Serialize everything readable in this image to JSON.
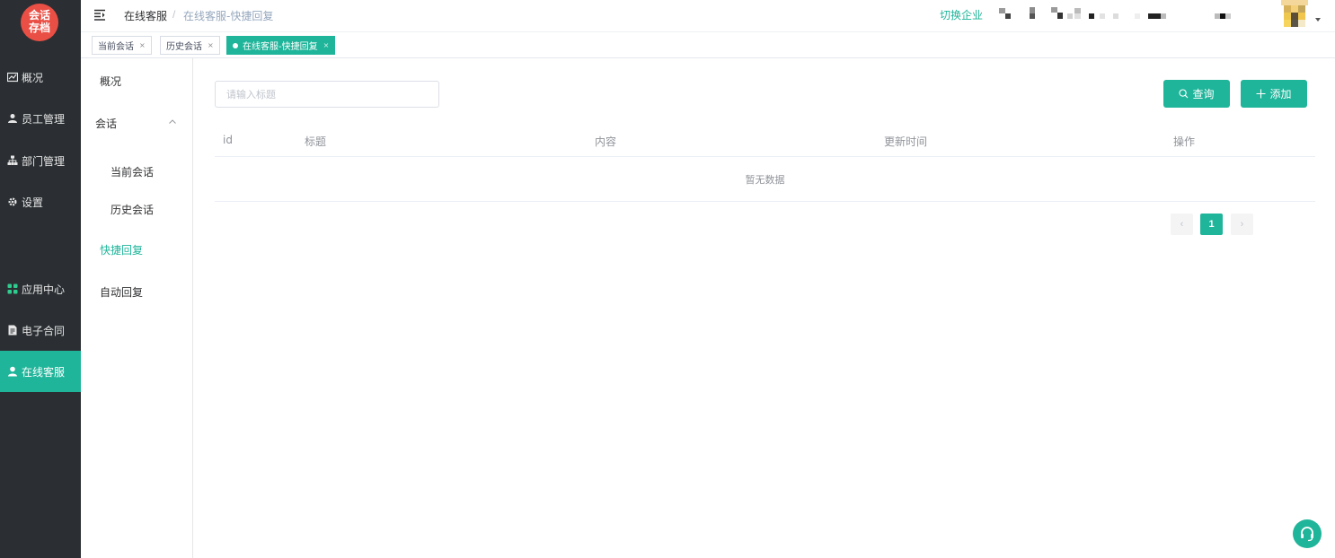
{
  "logo": {
    "line1": "会话",
    "line2": "存档",
    "color": "#ea4f45"
  },
  "sidenav": {
    "items": [
      {
        "label": "概况",
        "icon": "chart-icon"
      },
      {
        "label": "员工管理",
        "icon": "users-icon"
      },
      {
        "label": "部门管理",
        "icon": "org-icon"
      },
      {
        "label": "设置",
        "icon": "gear-icon"
      },
      {
        "label": "应用中心",
        "icon": "apps-icon"
      },
      {
        "label": "电子合同",
        "icon": "contract-icon"
      },
      {
        "label": "在线客服",
        "icon": "support-person-icon",
        "active": true
      }
    ],
    "active_color": "#1fb59a"
  },
  "header": {
    "breadcrumb": [
      "在线客服",
      "在线客服-快捷回复"
    ],
    "separator": "/",
    "switch_label": "切换企业"
  },
  "tags": [
    {
      "label": "当前会话",
      "close": "×"
    },
    {
      "label": "历史会话",
      "close": "×"
    },
    {
      "label": "在线客服-快捷回复",
      "close": "×",
      "active": true
    }
  ],
  "submenu": {
    "overview": "概况",
    "session_group": "会话",
    "current_session": "当前会话",
    "history_session": "历史会话",
    "quick_reply": "快捷回复",
    "auto_reply": "自动回复"
  },
  "search": {
    "placeholder": "请输入标题",
    "value": ""
  },
  "buttons": {
    "query": "查询",
    "add": "添加"
  },
  "table": {
    "columns": [
      "id",
      "标题",
      "内容",
      "更新时间",
      "操作"
    ],
    "rows": [],
    "empty_text": "暂无数据"
  },
  "pagination": {
    "prev": "‹",
    "current": "1",
    "next": "›"
  },
  "theme": {
    "accent": "#1fb59a",
    "sidebar_bg": "#2b2f33"
  }
}
